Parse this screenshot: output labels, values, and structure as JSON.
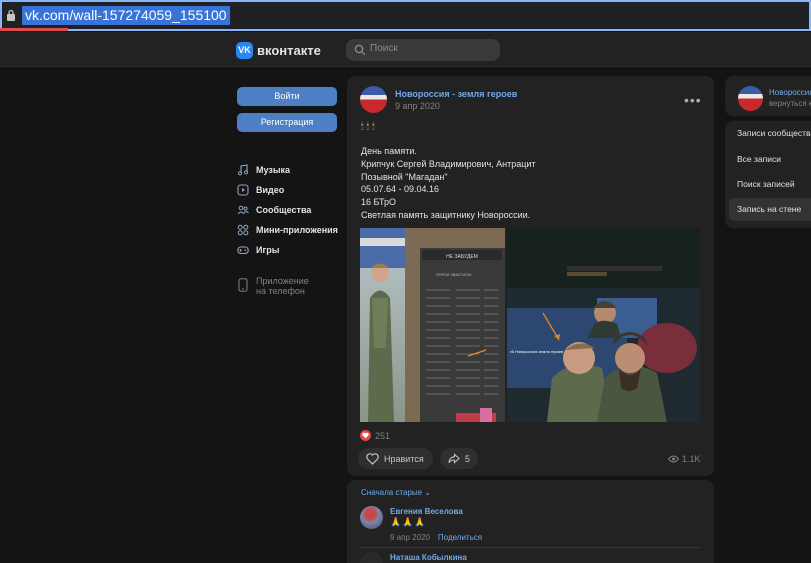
{
  "browser": {
    "url": "vk.com/wall-157274059_155100"
  },
  "header": {
    "logo_text": "вконтакте",
    "search_placeholder": "Поиск"
  },
  "auth": {
    "login": "Войти",
    "register": "Регистрация"
  },
  "nav": {
    "items": [
      {
        "label": "Музыка",
        "icon": "music-note-icon"
      },
      {
        "label": "Видео",
        "icon": "video-icon"
      },
      {
        "label": "Сообщества",
        "icon": "communities-icon"
      },
      {
        "label": "Мини-приложения",
        "icon": "mini-apps-icon"
      },
      {
        "label": "Игры",
        "icon": "gamepad-icon"
      }
    ],
    "app_promo": [
      "Приложение",
      "на телефон"
    ]
  },
  "post": {
    "author": "Новороссия - земля героев",
    "date": "9 апр 2020",
    "emoji": "🕯🕯🕯",
    "lines": [
      "День памяти.",
      "Крипчук Сергей Владимирович, Антрацит",
      "Позывной \"Магадан\"",
      "05.07.64 - 09.04.16",
      "16 БТрО",
      "Светлая память защитнику Новороссии."
    ],
    "photo_caption_1": "НЕ ЗАБУДЕМ",
    "photo_caption_2": "ГЕРОИ ЗВАСТАЛИ",
    "photo_caption_3": "vk Новороссия земля героев",
    "likes_count": "251",
    "like_label": "Нравится",
    "shares_count": "5",
    "views": "1.1K"
  },
  "comments": {
    "sort_label": "Сначала старые",
    "items": [
      {
        "author": "Евгения Веселова",
        "text": "🙏🙏🙏",
        "date": "9 апр 2020",
        "share": "Поделиться"
      },
      {
        "author": "Наташа Кобылкина"
      }
    ]
  },
  "sidebar": {
    "group_name": "Новороссия",
    "group_sub": "вернуться к",
    "menu": [
      {
        "label": "Записи сообщества",
        "active": false
      },
      {
        "label": "Все записи",
        "active": false
      },
      {
        "label": "Поиск записей",
        "active": false
      },
      {
        "label": "Запись на стене",
        "active": true
      }
    ]
  },
  "colors": {
    "accent": "#71aaeb",
    "button": "#4c7fc4",
    "like": "#e64646",
    "background": "#141414",
    "card": "#222222"
  }
}
